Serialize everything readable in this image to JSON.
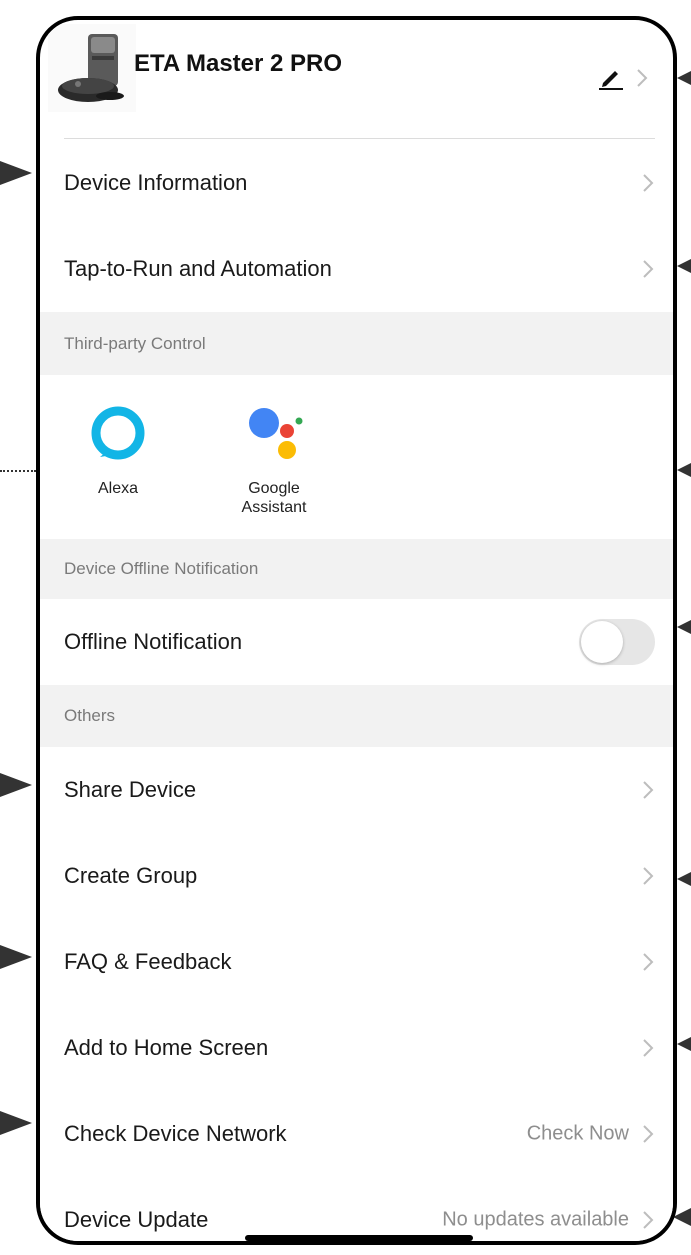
{
  "device": {
    "name": "ETA Master 2 PRO"
  },
  "menu": {
    "device_information": "Device Information",
    "tap_to_run": "Tap-to-Run and Automation",
    "offline_notification": "Offline Notification",
    "share_device": "Share Device",
    "create_group": "Create Group",
    "faq_feedback": "FAQ & Feedback",
    "add_home_screen": "Add to Home Screen",
    "check_network": "Check Device Network",
    "check_network_value": "Check Now",
    "device_update": "Device Update",
    "device_update_value": "No updates available"
  },
  "sections": {
    "third_party": "Third-party Control",
    "offline": "Device Offline Notification",
    "others": "Others"
  },
  "third_party": [
    {
      "label": "Alexa",
      "icon": "alexa-icon"
    },
    {
      "label": "Google Assistant",
      "icon": "google-assistant-icon"
    }
  ],
  "offline_notification_enabled": false,
  "colors": {
    "alexa": "#12b5e6",
    "google_blue": "#4285f4",
    "google_red": "#ea4335",
    "google_yellow": "#fbbc05",
    "google_green": "#34a853"
  }
}
